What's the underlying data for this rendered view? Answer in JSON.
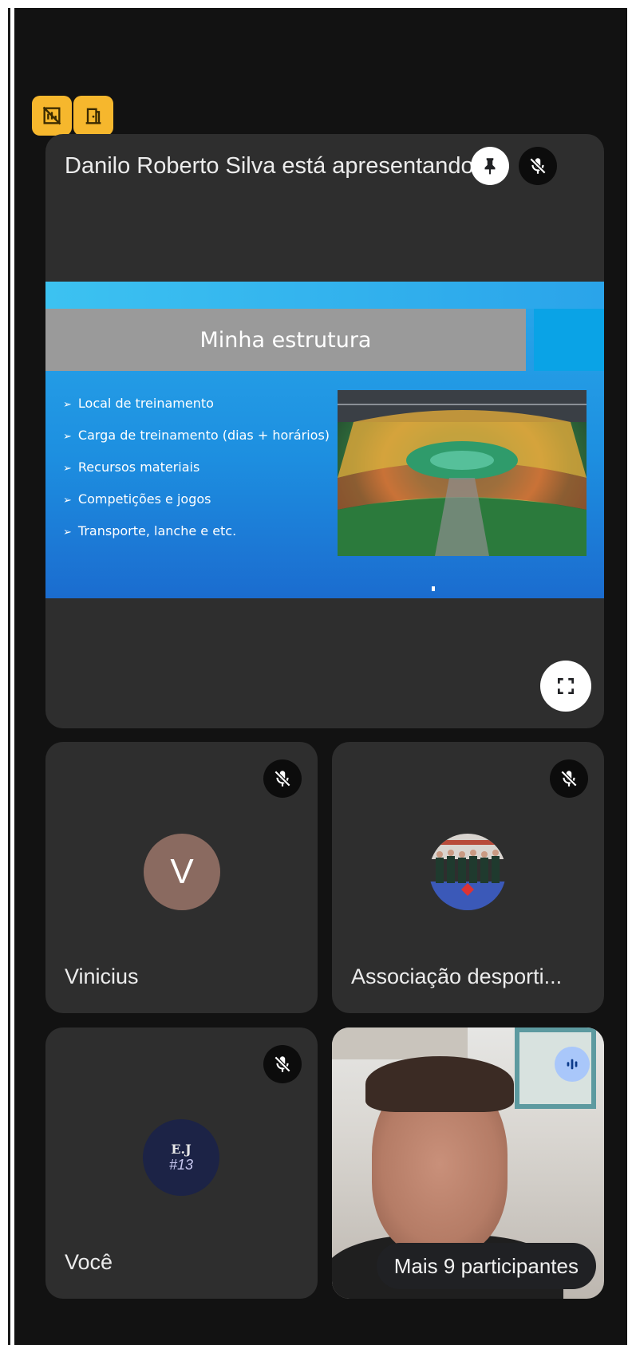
{
  "presentation": {
    "presenter_label": "Danilo Roberto Silva está apresentando",
    "slide": {
      "title": "Minha estrutura",
      "bullets": [
        "Local de treinamento",
        "Carga de treinamento (dias + horários)",
        "Recursos materiais",
        "Competições e jogos",
        "Transporte, lanche e etc."
      ]
    }
  },
  "participants": [
    {
      "name": "Vinicius",
      "initial": "V",
      "avatar_color": "#8a6a60",
      "muted": true
    },
    {
      "name": "Associação desporti...",
      "muted": true
    },
    {
      "name": "Você",
      "avatar_text": "E.J",
      "avatar_number": "#13",
      "muted": true
    },
    {
      "speaking": true
    }
  ],
  "more_participants_label": "Mais 9 participantes",
  "colors": {
    "background": "#121212",
    "tile": "#2e2e2e",
    "badge": "#f6b72d",
    "speaking": "#a9c7fa"
  }
}
